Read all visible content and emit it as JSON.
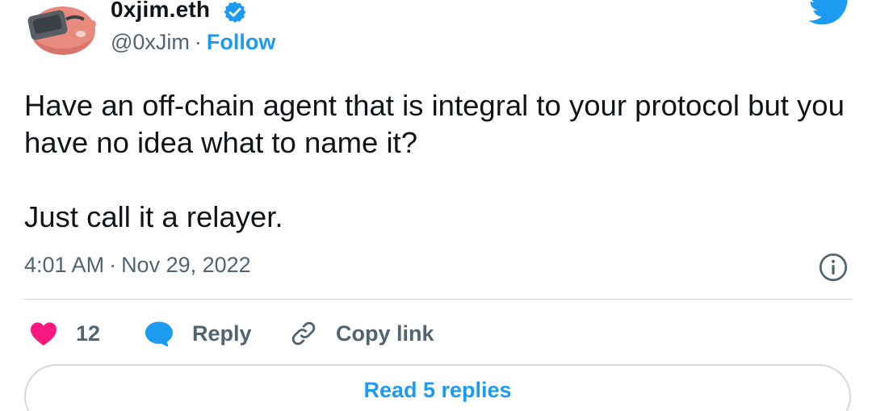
{
  "author": {
    "display_name": "0xjim.eth",
    "handle": "@0xJim",
    "separator": "·",
    "follow_label": "Follow",
    "verified": true,
    "avatar": "cartoon-pink-animal-with-vr-headset"
  },
  "tweet": {
    "paragraphs": [
      "Have an off-chain agent that is integral to your protocol but you have no idea what to name it?",
      "Just call it a relayer."
    ],
    "time": "4:01 AM",
    "separator": "·",
    "date": "Nov 29, 2022"
  },
  "actions": {
    "likes_count": "12",
    "reply_label": "Reply",
    "copy_link_label": "Copy link"
  },
  "read_replies_label": "Read 5 replies",
  "icons": {
    "brand": "twitter-bird-icon",
    "verified": "verified-badge-icon",
    "info": "info-icon",
    "like": "heart-icon",
    "reply": "speech-bubble-icon",
    "copy_link": "link-icon"
  },
  "colors": {
    "accent": "#1d9bf0",
    "like": "#f91880",
    "text": "#0f1419",
    "secondary_text": "#536471",
    "border": "#cfd9de"
  }
}
